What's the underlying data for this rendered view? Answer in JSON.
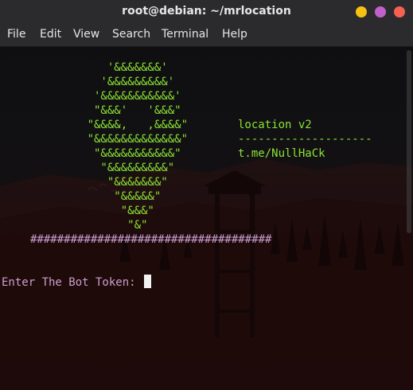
{
  "window": {
    "title": "root@debian: ~/mrlocation",
    "buttons": {
      "minimize_color": "#f5c211",
      "maximize_color": "#c061cb",
      "close_color": "#f66151"
    }
  },
  "menubar": {
    "items": [
      "File",
      "Edit",
      "View",
      "Search",
      "Terminal",
      "Help"
    ]
  },
  "terminal": {
    "art_lines": [
      "                '&&&&&&&'",
      "               '&&&&&&&&&'",
      "              '&&&&&&&&&&&'",
      "              \"&&&'   '&&&\"",
      "             \"&&&&,   ,&&&&\"",
      "             \"&&&&&&&&&&&&&\"",
      "              \"&&&&&&&&&&&\"",
      "               \"&&&&&&&&&\"",
      "                \"&&&&&&&\"",
      "                 \"&&&&&\"",
      "                  \"&&&\"",
      "                   \"&\""
    ],
    "info": {
      "name": "location v2",
      "separator": "--------------------",
      "link": "t.me/NullHaCk"
    },
    "hash_rule": "####################################",
    "prompt": "Enter The Bot Token: ",
    "colors": {
      "art": "#8ae234",
      "prompt": "#c8a0cc",
      "hash": "#c89fcf"
    }
  }
}
